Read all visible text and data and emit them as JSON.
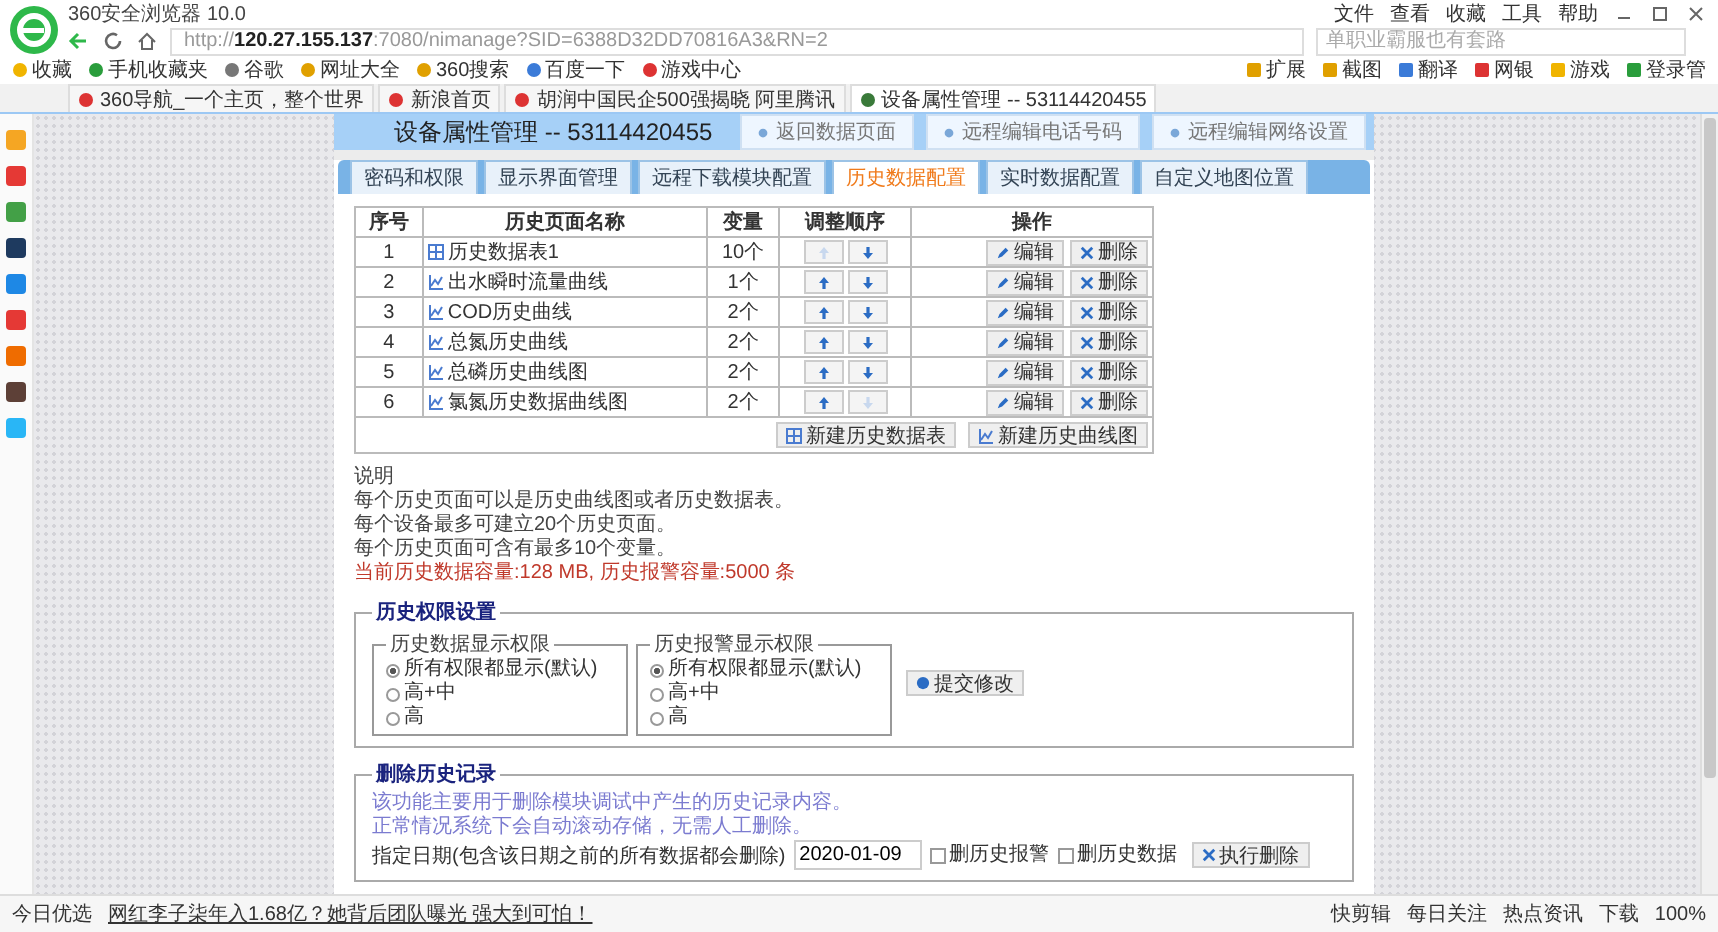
{
  "window": {
    "title": "360安全浏览器 10.0",
    "menu": [
      "文件",
      "查看",
      "收藏",
      "工具",
      "帮助"
    ]
  },
  "address_bar": {
    "url": "http://**120.27.155.137**:7080/nimanage?SID=6388D32DD70816A3&RN=2"
  },
  "search": {
    "placeholder": "单职业霸服也有套路"
  },
  "bookmarks": [
    "收藏",
    "手机收藏夹",
    "谷歌",
    "网址大全",
    "360搜索",
    "百度一下",
    "游戏中心"
  ],
  "toolbar": [
    "扩展",
    "截图",
    "翻译",
    "网银",
    "游戏",
    "登录管"
  ],
  "tabs": [
    {
      "label": "360导航_一个主页，整个世界",
      "selected": false
    },
    {
      "label": "新浪首页",
      "selected": false
    },
    {
      "label": "胡润中国民企500强揭晓 阿里腾讯",
      "selected": false
    },
    {
      "label": "设备属性管理 -- 53114420455",
      "selected": true
    }
  ],
  "page": {
    "title": "设备属性管理 -- 53114420455",
    "header_buttons": [
      "返回数据页面",
      "远程编辑电话号码",
      "远程编辑网络设置"
    ],
    "tabs": [
      {
        "label": "密码和权限",
        "selected": false
      },
      {
        "label": "显示界面管理",
        "selected": false
      },
      {
        "label": "远程下载模块配置",
        "selected": false
      },
      {
        "label": "历史数据配置",
        "selected": true
      },
      {
        "label": "实时数据配置",
        "selected": false
      },
      {
        "label": "自定义地图位置",
        "selected": false
      }
    ],
    "table": {
      "columns": [
        "序号",
        "历史页面名称",
        "变量",
        "调整顺序",
        "操作"
      ],
      "rows": [
        {
          "index": "1",
          "kind": "table",
          "name": "历史数据表1",
          "variables": "10个",
          "up_disabled": true,
          "down_disabled": false,
          "actions": [
            "编辑",
            "删除"
          ]
        },
        {
          "index": "2",
          "kind": "curve",
          "name": "出水瞬时流量曲线",
          "variables": "1个",
          "up_disabled": false,
          "down_disabled": false,
          "actions": [
            "编辑",
            "删除"
          ]
        },
        {
          "index": "3",
          "kind": "curve",
          "name": "COD历史曲线",
          "variables": "2个",
          "up_disabled": false,
          "down_disabled": false,
          "actions": [
            "编辑",
            "删除"
          ]
        },
        {
          "index": "4",
          "kind": "curve",
          "name": "总氮历史曲线",
          "variables": "2个",
          "up_disabled": false,
          "down_disabled": false,
          "actions": [
            "编辑",
            "删除"
          ]
        },
        {
          "index": "5",
          "kind": "curve",
          "name": "总磷历史曲线图",
          "variables": "2个",
          "up_disabled": false,
          "down_disabled": false,
          "actions": [
            "编辑",
            "删除"
          ]
        },
        {
          "index": "6",
          "kind": "curve",
          "name": "氯氮历史数据曲线图",
          "variables": "2个",
          "up_disabled": false,
          "down_disabled": true,
          "actions": [
            "编辑",
            "删除"
          ]
        }
      ],
      "footer_buttons": [
        {
          "kind": "table",
          "label": "新建历史数据表"
        },
        {
          "kind": "curve",
          "label": "新建历史曲线图"
        }
      ]
    },
    "notes": {
      "heading": "说明",
      "lines": [
        "每个历史页面可以是历史曲线图或者历史数据表。",
        "每个设备最多可建立20个历史页面。",
        "每个历史页面可含有最多10个变量。"
      ],
      "warning": "当前历史数据容量:128 MB, 历史报警容量:5000 条"
    },
    "permissions": {
      "legend": "历史权限设置",
      "groups": [
        {
          "legend": "历史数据显示权限",
          "options": [
            {
              "label": "所有权限都显示(默认)",
              "selected": true
            },
            {
              "label": "高+中",
              "selected": false
            },
            {
              "label": "高",
              "selected": false
            }
          ]
        },
        {
          "legend": "历史报警显示权限",
          "options": [
            {
              "label": "所有权限都显示(默认)",
              "selected": true
            },
            {
              "label": "高+中",
              "selected": false
            },
            {
              "label": "高",
              "selected": false
            }
          ]
        }
      ],
      "submit": "提交修改"
    },
    "delete_history": {
      "legend": "删除历史记录",
      "info": [
        "该功能主要用于删除模块调试中产生的历史记录内容。",
        "正常情况系统下会自动滚动存储，无需人工删除。"
      ],
      "date_label": "指定日期(包含该日期之前的所有数据都会删除)",
      "date_value": "2020-01-09",
      "options": [
        {
          "label": "删历史报警",
          "checked": false
        },
        {
          "label": "删历史数据",
          "checked": false
        }
      ],
      "submit": "执行删除"
    }
  },
  "status_bar": {
    "left": "今日优选",
    "news": "网红李子柒年入1.68亿？她背后团队曝光 强大到可怕！",
    "items": [
      "快剪辑",
      "每日关注",
      "热点资讯",
      "下载"
    ],
    "zoom": "100%"
  }
}
